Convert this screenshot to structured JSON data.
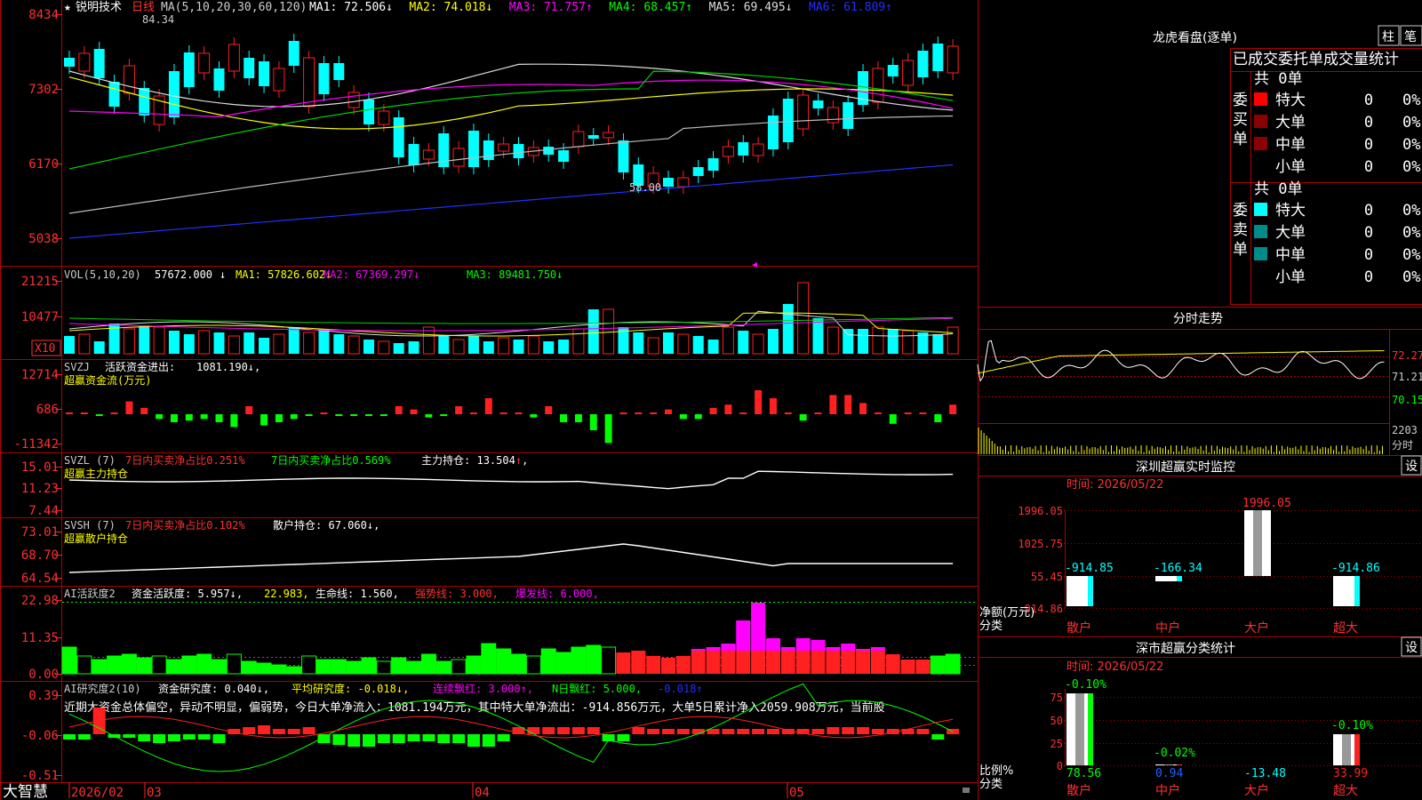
{
  "colors": {
    "up": "#ff2020",
    "down": "#00ffff",
    "frame": "#b00000",
    "yellow": "#ffff00",
    "magenta": "#ff00ff",
    "green": "#00d000",
    "white": "#dddddd",
    "blue": "#2030ff",
    "gray": "#bbbbbb",
    "lime": "#00ff00",
    "labelRed": "#ff3030"
  },
  "main": {
    "star": "★",
    "stock_name": "锐明技术",
    "period": "日线",
    "ma_prefix": "MA(5,10,20,30,60,120)",
    "legend": [
      {
        "label": "MA1:",
        "value": "72.506",
        "arrow": "↓",
        "color": "#ffffff"
      },
      {
        "label": "MA2:",
        "value": "74.018",
        "arrow": "↓",
        "color": "#ffff00"
      },
      {
        "label": "MA3:",
        "value": "71.757",
        "arrow": "↑",
        "color": "#ff00ff"
      },
      {
        "label": "MA4:",
        "value": "68.457",
        "arrow": "↑",
        "color": "#00ff00"
      },
      {
        "label": "MA5:",
        "value": "69.495",
        "arrow": "↓",
        "color": "#dddddd"
      },
      {
        "label": "MA6:",
        "value": "61.809",
        "arrow": "↑",
        "color": "#2030ff"
      }
    ],
    "y_ticks": [
      "8434",
      "7302",
      "6170",
      "5038"
    ],
    "high_label": "84.34",
    "low_label": "58.00"
  },
  "chart_data": [
    {
      "type": "candlestick",
      "name": "日线",
      "ylim": [
        50,
        84.34
      ],
      "high": 84.34,
      "low": 58.0,
      "y_ticks": [
        "8434",
        "7302",
        "6170",
        "5038"
      ],
      "ma_lines": [
        "MA1",
        "MA2",
        "MA3",
        "MA4",
        "MA5",
        "MA6"
      ],
      "ma_last": [
        72.506,
        74.018,
        71.757,
        68.457,
        69.495,
        61.809
      ]
    },
    {
      "type": "bar",
      "name": "VOL(5,10,20)",
      "current": "57672.000",
      "y_ticks": [
        "21215",
        "10477"
      ],
      "unit": "X10",
      "lines": [
        {
          "name": "MA1",
          "value": "57826.602",
          "arrow": "↓"
        },
        {
          "name": "MA2",
          "value": "67369.297",
          "arrow": "↓"
        },
        {
          "name": "MA3",
          "value": "89481.750",
          "arrow": "↓"
        }
      ]
    },
    {
      "type": "bar",
      "name": "SVZJ",
      "y_ticks": [
        "12714",
        "686",
        "-11342"
      ]
    },
    {
      "type": "line",
      "name": "SVZL (7)",
      "y_ticks": [
        "15.01",
        "11.23",
        "7.44"
      ]
    },
    {
      "type": "line",
      "name": "SVSH (7)",
      "y_ticks": [
        "73.01",
        "68.70",
        "64.54"
      ]
    },
    {
      "type": "bar",
      "name": "AI活跃度2",
      "y_ticks": [
        "22.98",
        "11.35",
        "0.00"
      ]
    },
    {
      "type": "bar",
      "name": "AI研究度2(10)",
      "y_ticks": [
        "0.39",
        "-0.06",
        "-0.51"
      ]
    },
    {
      "type": "bar",
      "name": "深圳超赢实时监控",
      "categories": [
        "散户",
        "中户",
        "大户",
        "超大"
      ],
      "values": [
        -914.85,
        -166.34,
        1996.05,
        -914.86
      ],
      "y_ticks": [
        "1996.05",
        "1025.75",
        "55.45",
        "-914.86"
      ],
      "ylabel": "净额(万元)",
      "xlabel": "分类"
    },
    {
      "type": "bar",
      "name": "深市超赢分类统计",
      "categories": [
        "散户",
        "中户",
        "大户",
        "超大"
      ],
      "values": [
        78.56,
        0.94,
        -13.48,
        33.99
      ],
      "top_labels": [
        "-0.10%",
        "-0.02%",
        "",
        "-0.10%"
      ],
      "y_ticks": [
        "75",
        "50",
        "25",
        "0"
      ],
      "ylabel": "比例%",
      "xlabel": "分类"
    }
  ],
  "vol": {
    "title": "VOL(5,10,20)",
    "current": "57672.000",
    "ma1": "57826.602",
    "ma2": "67369.297",
    "ma3": "89481.750",
    "arrow": "↓",
    "unit": "X10",
    "y_ticks": [
      "21215",
      "10477"
    ]
  },
  "svzj": {
    "title": "SVZJ",
    "line1": "活跃资金进出:",
    "value": "1081.190",
    "arrow": "↓",
    "sub": "超赢资金流(万元)",
    "y_ticks": [
      "12714",
      "686",
      "-11342"
    ]
  },
  "svzl": {
    "title": "SVZL (7)",
    "t1": "7日内买卖净占比0.251%",
    "t2": "7日内买卖净占比0.569%",
    "t3": "主力持仓:",
    "value": "13.504",
    "arrow": "↑",
    "sub": "超赢主力持仓",
    "y_ticks": [
      "15.01",
      "11.23",
      "7.44"
    ]
  },
  "svsh": {
    "title": "SVSH (7)",
    "t1": "7日内买卖净占比0.102%",
    "t3": "散户持仓:",
    "value": "67.060",
    "arrow": "↓",
    "sub": "超赢散户持仓",
    "y_ticks": [
      "73.01",
      "68.70",
      "64.54"
    ]
  },
  "ai1": {
    "title": "AI活跃度2",
    "t1": "资金活跃度:",
    "v1": "5.957",
    "a1": "↓",
    "v2": "22.983",
    "t3": "生命线:",
    "v3": "1.560",
    "t4": "强势线:",
    "v4": "3.000",
    "t5": "爆发线:",
    "v5": "6.000",
    "y_ticks": [
      "22.98",
      "11.35",
      "0.00"
    ]
  },
  "ai2": {
    "title": "AI研究度2(10)",
    "t1": "资金研究度:",
    "v1": "0.040",
    "a1": "↓",
    "t2": "平均研究度:",
    "v2": "-0.018",
    "a2": "↓",
    "t3": "连续飘红:",
    "v3": "3.000",
    "a3": "↑",
    "t4": "N日飘红:",
    "v4": "5.000",
    "v5": "-0.018",
    "a5": "↑",
    "desc": "近期大资金总体偏空，异动不明显，偏弱势，今日大单净流入：1081.194万元，其中特大单净流出：-914.856万元，大单5日累计净入2059.908万元，当前股",
    "y_ticks": [
      "0.39",
      "-0.06",
      "-0.51"
    ]
  },
  "bottom": {
    "brand": "大智慧",
    "dates": [
      "2026/02",
      "03",
      "04",
      "05"
    ]
  },
  "lhb": {
    "title": "龙虎看盘(逐单)",
    "btn1": "柱",
    "btn2": "笔",
    "header": "已成交委托单成交量统计",
    "buy": {
      "side": "委买单",
      "total": "共 0单",
      "rows": [
        {
          "name": "特大",
          "count": "0",
          "pct": "0%"
        },
        {
          "name": "大单",
          "count": "0",
          "pct": "0%"
        },
        {
          "name": "中单",
          "count": "0",
          "pct": "0%"
        },
        {
          "name": "小单",
          "count": "0",
          "pct": "0%"
        }
      ]
    },
    "sell": {
      "side": "委卖单",
      "total": "共 0单",
      "rows": [
        {
          "name": "特大",
          "count": "0",
          "pct": "0%"
        },
        {
          "name": "大单",
          "count": "0",
          "pct": "0%"
        },
        {
          "name": "中单",
          "count": "0",
          "pct": "0%"
        },
        {
          "name": "小单",
          "count": "0",
          "pct": "0%"
        }
      ]
    }
  },
  "fenshi": {
    "title": "分时走势",
    "p1": "72.27",
    "p2": "71.21",
    "p3": "70.15",
    "v1": "2203",
    "v2": "分时"
  },
  "sz": {
    "title": "深圳超赢实时监控",
    "set": "设",
    "time": "时间: 2026/05/22",
    "y_ticks": [
      "1996.05",
      "1025.75",
      "55.45",
      "-914.86"
    ],
    "bar_labels": [
      "-914.85",
      "-166.34",
      "1996.05",
      "-914.86"
    ],
    "ylabel": "净额(万元)",
    "xlabel": "分类",
    "cats": [
      "散户",
      "中户",
      "大户",
      "超大"
    ]
  },
  "ss": {
    "title": "深市超赢分类统计",
    "set": "设",
    "time": "时间: 2026/05/22",
    "y_ticks": [
      "75",
      "50",
      "25",
      "0"
    ],
    "top_labels": [
      "-0.10%",
      "-0.02%",
      "",
      "-0.10%"
    ],
    "bottom_values": [
      "78.56",
      "0.94",
      "-13.48",
      "33.99"
    ],
    "ylabel": "比例%",
    "xlabel": "分类",
    "cats": [
      "散户",
      "中户",
      "大户",
      "超大"
    ]
  }
}
